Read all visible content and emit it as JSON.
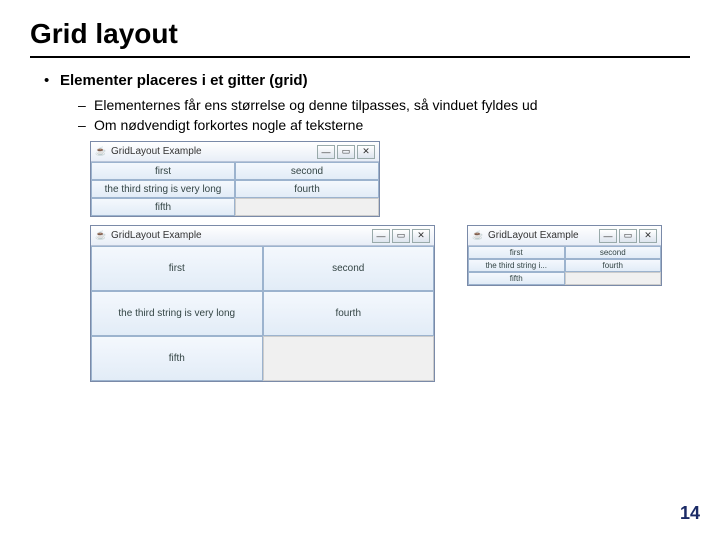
{
  "slide": {
    "title": "Grid layout",
    "bullet_main": "Elementer placeres i et gitter (grid)",
    "sub_bullets": [
      "Elementernes får ens størrelse og denne tilpasses, så vinduet fyldes ud",
      "Om nødvendigt forkortes nogle af teksterne"
    ],
    "page_number": "14"
  },
  "windows": {
    "w1": {
      "title": "GridLayout Example",
      "cells": [
        "first",
        "second",
        "the third string is very long",
        "fourth",
        "fifth",
        ""
      ]
    },
    "w2": {
      "title": "GridLayout Example",
      "cells": [
        "first",
        "second",
        "the third string is very long",
        "fourth",
        "fifth",
        ""
      ]
    },
    "w3": {
      "title": "GridLayout Example",
      "cells": [
        "first",
        "second",
        "the third string i...",
        "fourth",
        "fifth",
        ""
      ]
    }
  },
  "controls": {
    "min": "—",
    "max": "▭",
    "close": "✕"
  },
  "icon_glyph": "☕"
}
